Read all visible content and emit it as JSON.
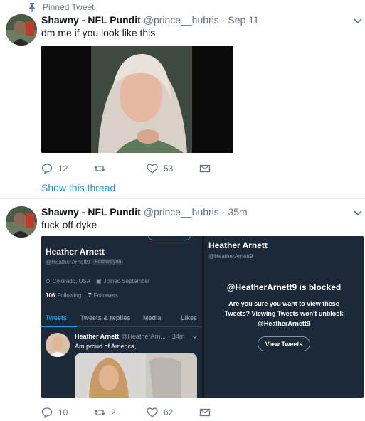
{
  "pinned": {
    "label": "Pinned Tweet"
  },
  "tweet1": {
    "author_name": "Shawny - NFL Pundit",
    "handle": "@prince__hubris",
    "separator": "·",
    "time": "Sep 11",
    "text": "dm me if you look like this",
    "replies": "12",
    "likes": "53",
    "show_thread": "Show this thread"
  },
  "tweet2": {
    "author_name": "Shawny - NFL Pundit",
    "handle": "@prince__hubris",
    "separator": "·",
    "time": "35m",
    "text": "fuck off dyke",
    "replies": "10",
    "retweets": "2",
    "likes": "62",
    "embedded": {
      "left": {
        "name": "Heather Arnett",
        "handle": "@HeatherArnett9",
        "follows_badge": "Follows you",
        "location": "Colorado, USA",
        "joined": "Joined September",
        "following_count": "106",
        "following_label": "Following",
        "followers_count": "7",
        "followers_label": "Followers",
        "tabs": [
          "Tweets",
          "Tweets & replies",
          "Media",
          "Likes"
        ],
        "inner_name": "Heather Arnett",
        "inner_handle": "@HeatherArn...",
        "inner_separator": "·",
        "inner_time": "34m",
        "inner_text": "Am proud of America,"
      },
      "right": {
        "name": "Heather Arnett",
        "handle": "@HeatherArnett9",
        "blocked_title": "@HeatherArnett9 is blocked",
        "blocked_body": "Are you sure you want to view these Tweets? Viewing Tweets won't unblock @HeatherArnett9",
        "view_button": "View Tweets"
      }
    }
  },
  "colors": {
    "link": "#1b95e0",
    "muted": "#657786",
    "dark_panel": "#1c2938",
    "accent": "#1da1f2"
  }
}
